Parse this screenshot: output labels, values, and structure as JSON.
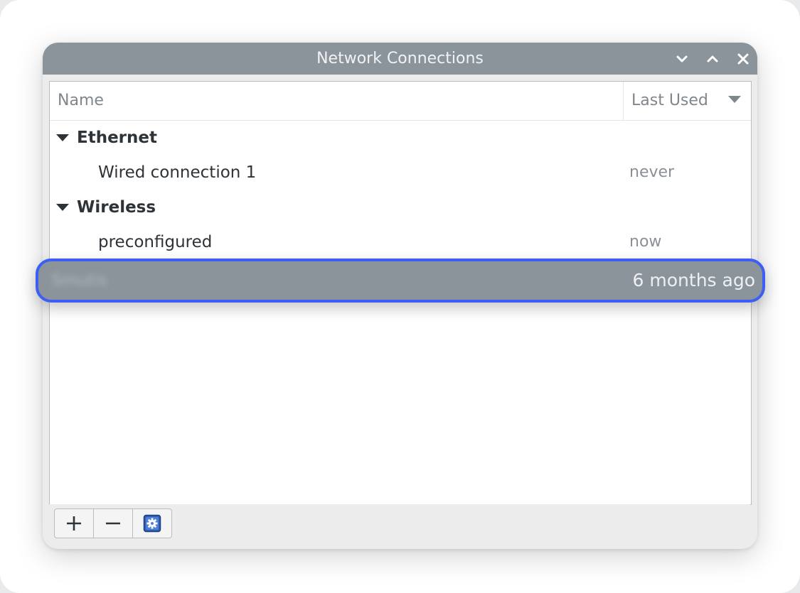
{
  "window": {
    "title": "Network Connections",
    "controls": [
      "chevron-down-icon",
      "chevron-up-icon",
      "close-icon"
    ]
  },
  "table": {
    "columns": {
      "name": "Name",
      "last_used": "Last Used"
    },
    "groups": [
      {
        "label": "Ethernet",
        "items": [
          {
            "name": "Wired connection 1",
            "last_used": "never"
          }
        ]
      },
      {
        "label": "Wireless",
        "items": [
          {
            "name": "preconfigured",
            "last_used": "now"
          },
          {
            "name": "Smutis",
            "last_used": "6 months ago",
            "selected": true
          }
        ]
      }
    ]
  },
  "toolbar": {
    "buttons": [
      "plus-icon",
      "minus-icon",
      "settings-gear-icon"
    ]
  },
  "colors": {
    "titlebar": "#8b939b",
    "selection_border": "#3c5ef5",
    "settings_icon": "#2f5fb3"
  }
}
